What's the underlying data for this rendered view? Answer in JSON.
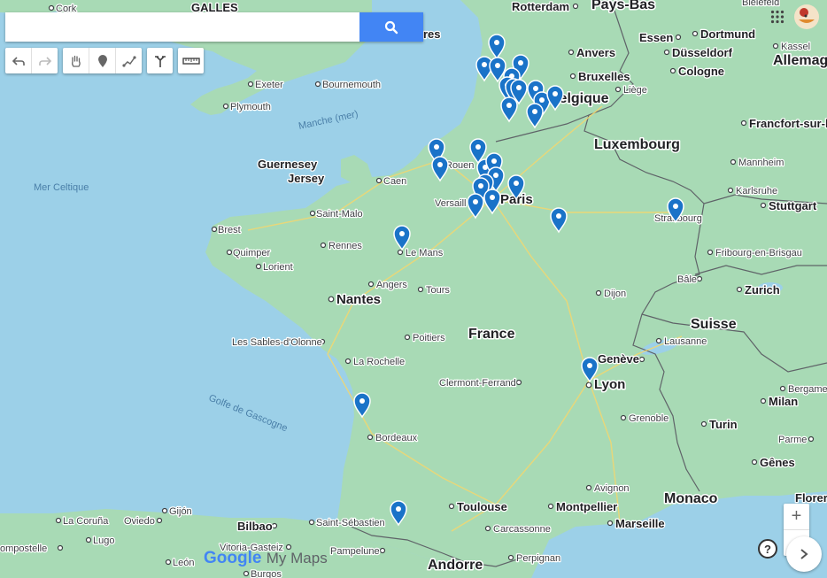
{
  "search": {
    "placeholder": "",
    "value": ""
  },
  "toolbar": {
    "undo": "undo-icon",
    "redo": "redo-icon",
    "pan": "hand-icon",
    "marker": "marker-icon",
    "line": "line-icon",
    "route": "route-icon",
    "measure": "ruler-icon"
  },
  "zoom": {
    "in": "+",
    "out": "−"
  },
  "help": "?",
  "logo": {
    "google": "Google",
    "mymaps": "My Maps"
  },
  "colors": {
    "land": "#a8dab5",
    "sea": "#9cd0e8",
    "pin": "#1a73c8",
    "border": "#5f6368"
  },
  "labels": {
    "countries": [
      "France",
      "Suisse",
      "Luxembourg",
      "Belgique",
      "Allemag",
      "Andorre",
      "Monaco",
      "GALLES",
      "Pays-Bas"
    ],
    "cities": [
      "Paris",
      "Lyon",
      "Nantes",
      "Rennes",
      "Le Mans",
      "Bordeaux",
      "Toulouse",
      "Montpellier",
      "Marseille",
      "Strasbourg",
      "Dijon",
      "Zurich",
      "Genève",
      "Turin",
      "Milan",
      "Bruxelles",
      "Düsseldorf",
      "Cologne",
      "Dortmund",
      "Essen",
      "Anvers",
      "Liège",
      "Rotterdam",
      "Kassel",
      "Francfort-sur-le",
      "Mannheim",
      "Karlsruhe",
      "Stuttgart",
      "Fribourg-en-Brisgau",
      "Bâle",
      "Lausanne",
      "Bergame",
      "Parme",
      "Gênes",
      "Grenoble",
      "Avignon",
      "Carcassonne",
      "Perpignan",
      "Clermont-Ferrand",
      "Poitiers",
      "La Rochelle",
      "Les Sables-d'Olonne",
      "Angers",
      "Tours",
      "Brest",
      "Quimper",
      "Lorient",
      "Saint-Malo",
      "Caen",
      "Rouen",
      "Versaill",
      "Exeter",
      "Bournemouth",
      "Plymouth",
      "Cork",
      "Bilbao",
      "Vitoria-Gasteiz",
      "Pampelune",
      "Saint-Sébastien",
      "Gijón",
      "Oviedo",
      "La Coruña",
      "Lugo",
      "León",
      "Burgos",
      "ompostelle",
      "Guernesey",
      "Jersey",
      "Florer",
      "Bielefeld",
      "res"
    ],
    "seas": [
      "Manche (mer)",
      "Mer Celtique",
      "Golfe de Gascogne"
    ]
  }
}
